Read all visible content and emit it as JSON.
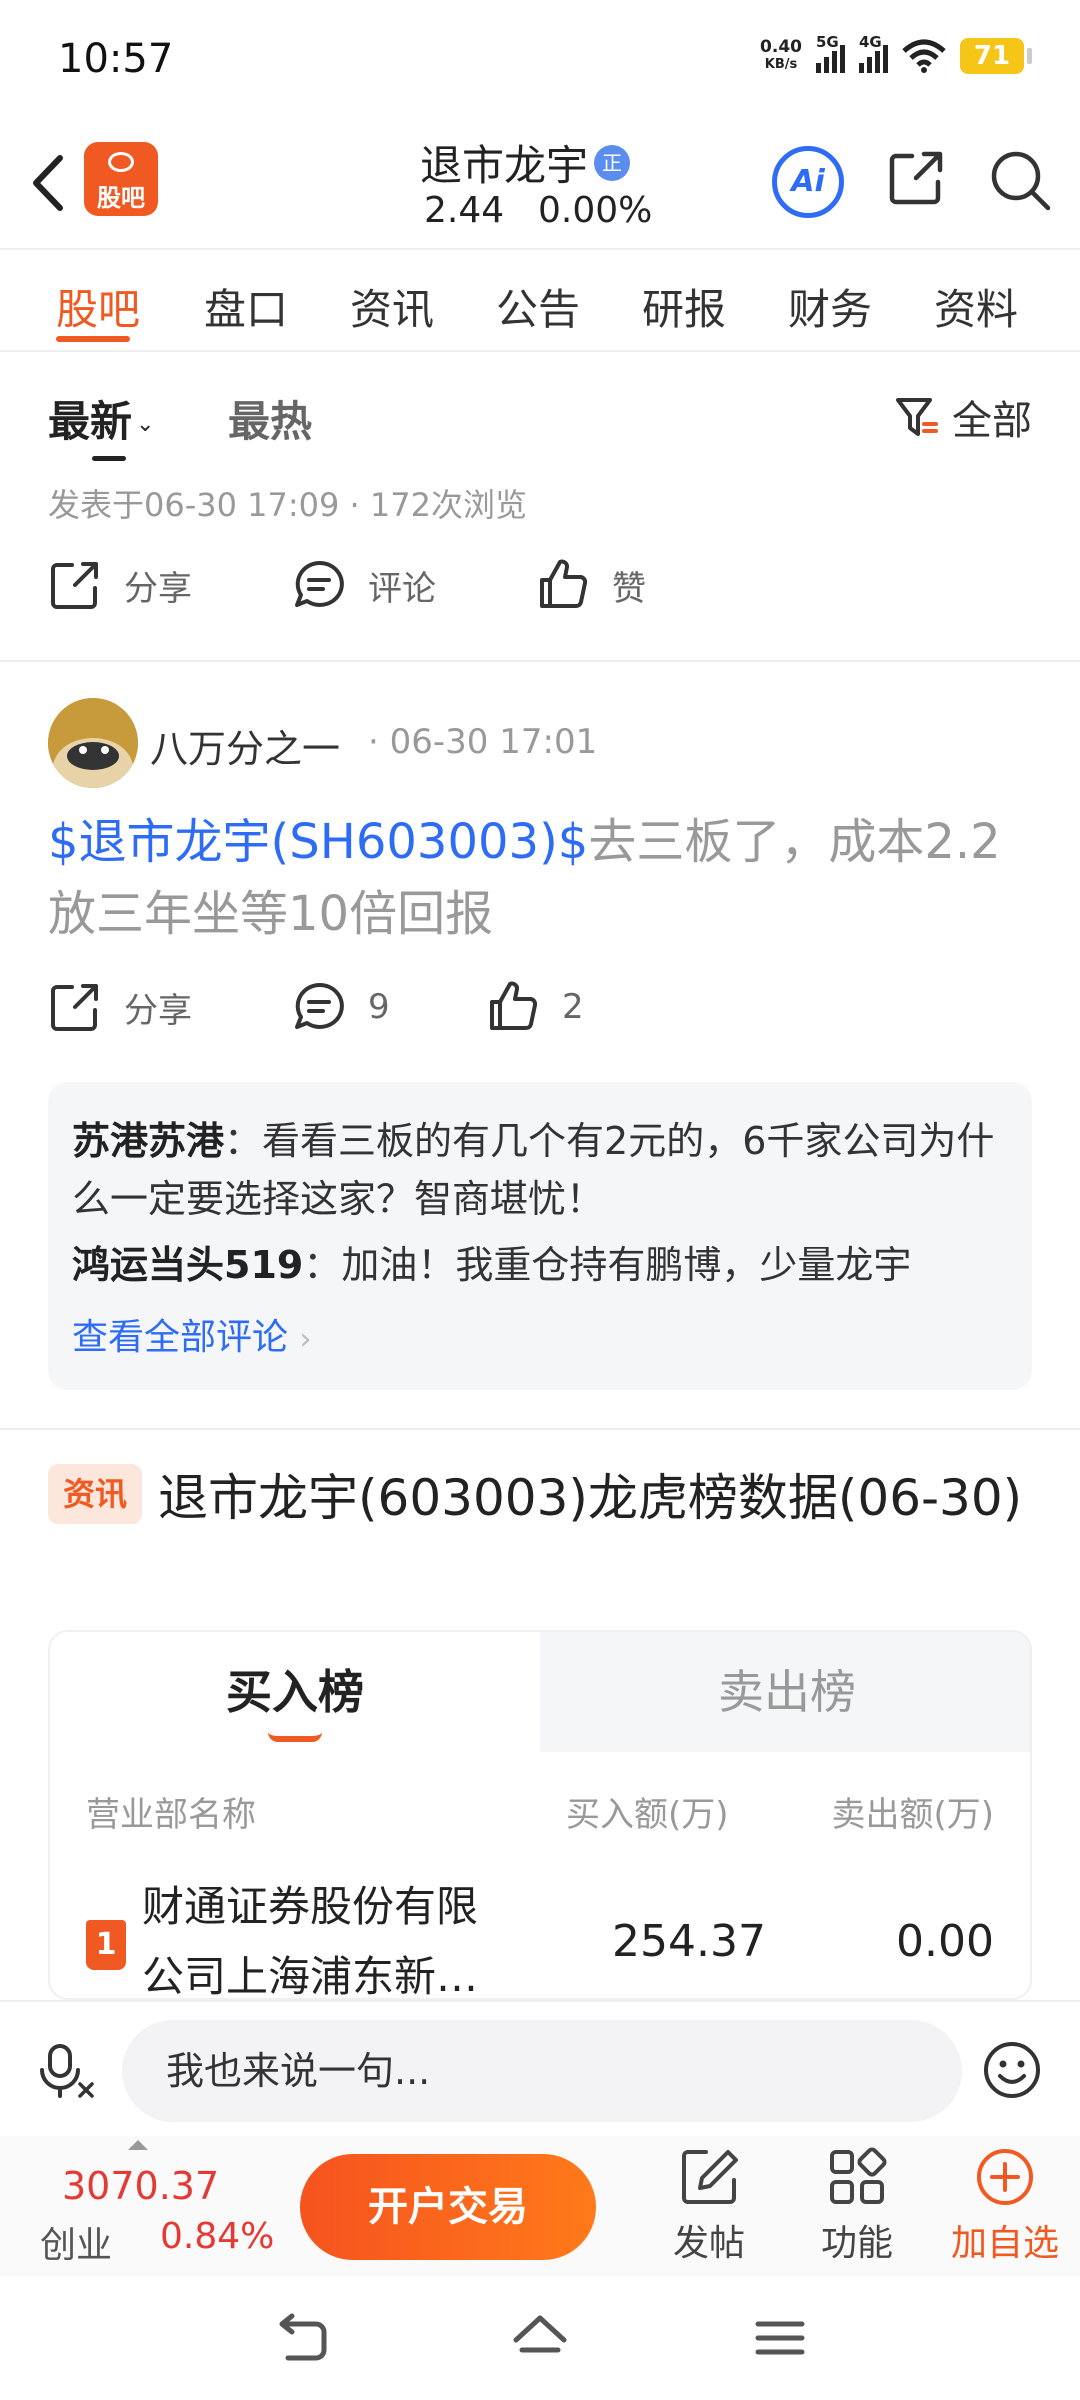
{
  "status_bar": {
    "time": "10:57",
    "net_speed_value": "0.40",
    "net_speed_unit": "KB/s",
    "sim1": "5G",
    "sim2": "4G",
    "battery": "71"
  },
  "header": {
    "back_icon": "chevron-left-icon",
    "app_logo_label": "股吧",
    "stock_name": "退市龙宇",
    "badge": "正",
    "price": "2.44",
    "change_pct": "0.00%",
    "ai_label": "Ai"
  },
  "tabs": [
    "股吧",
    "盘口",
    "资讯",
    "公告",
    "研报",
    "财务",
    "资料"
  ],
  "sort": {
    "latest": "最新",
    "hot": "最热",
    "filter": "全部"
  },
  "first_post": {
    "meta": "发表于06-30 17:09 · 172次浏览",
    "share": "分享",
    "comment": "评论",
    "like": "赞"
  },
  "second_post": {
    "author": "八万分之一",
    "time": "· 06-30 17:01",
    "link_text": "$退市龙宇(SH603003)$",
    "text": "去三板了，成本2.2放三年坐等10倍回报",
    "share": "分享",
    "comment_count": "9",
    "like_count": "2",
    "comments": [
      {
        "user": "苏港苏港",
        "text": "：看看三板的有几个有2元的，6千家公司为什么一定要选择这家？智商堪忧！"
      },
      {
        "user": "鸿运当头519",
        "text": "：加油！我重仓持有鹏博，少量龙宇"
      }
    ],
    "view_all": "查看全部评论"
  },
  "news": {
    "badge": "资讯",
    "title": "退市龙宇(603003)龙虎榜数据(06-30)",
    "tab_buy": "买入榜",
    "tab_sell": "卖出榜",
    "col_name": "营业部名称",
    "col_buy": "买入额(万)",
    "col_sell": "卖出额(万)",
    "rows": [
      {
        "rank": "1",
        "name": "财通证券股份有限公司上海浦东新…",
        "buy": "254.37",
        "sell": "0.00"
      }
    ]
  },
  "input_bar": {
    "placeholder": "我也来说一句..."
  },
  "bottom_bar": {
    "index_value": "3070.37",
    "index_name": "创业",
    "index_pct": "0.84%",
    "trade_button": "开户交易",
    "post": "发帖",
    "functions": "功能",
    "add_watch": "加自选"
  },
  "colors": {
    "accent": "#f05a22",
    "link": "#2e6cf6",
    "up_red": "#e53935"
  }
}
